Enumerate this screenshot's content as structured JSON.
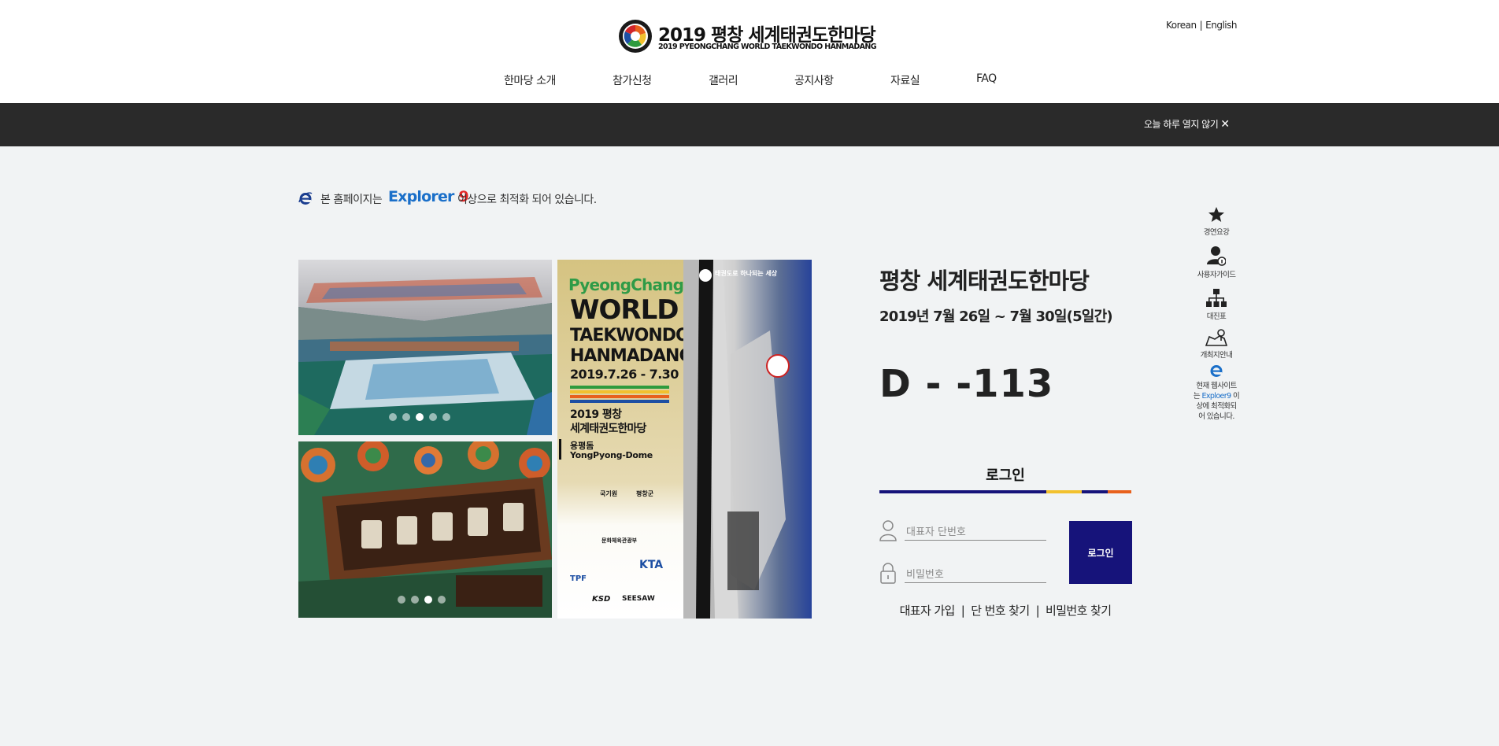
{
  "header": {
    "logo_title": "2019 평창 세계태권도한마당",
    "logo_subtitle": "2019 PYEONGCHANG WORLD TAEKWONDO HANMADANG",
    "lang_korean": "Korean",
    "lang_sep": "|",
    "lang_english": "English"
  },
  "nav": {
    "items": [
      {
        "label": "한마당 소개"
      },
      {
        "label": "참가신청"
      },
      {
        "label": "갤러리"
      },
      {
        "label": "공지사항"
      },
      {
        "label": "자료실"
      },
      {
        "label": "FAQ"
      }
    ]
  },
  "popup_bar": {
    "close_today": "오늘 하루 열지 않기",
    "close_icon": "✕"
  },
  "notice": {
    "text_before": "본 홈페이지는",
    "browser": "Explorer",
    "version": "9",
    "text_after": "이상으로 최적화 되어 있습니다."
  },
  "poster": {
    "brand": "PyeongChang",
    "line1": "WORLD",
    "line2": "TAEKWONDO",
    "line3": "HANMADANG",
    "dates": "2019.7.26 - 7.30",
    "ko_line1": "2019 평창",
    "ko_line2": "세계태권도한마당",
    "venue_ko": "용평돔",
    "venue_en": "YongPyong-Dome",
    "tagline": "태권도로 하나되는 세상",
    "sponsor_a": "국기원",
    "sponsor_b": "평창군",
    "sponsor_c": "문화체육관광부",
    "sponsor_d": "KTA",
    "sponsor_e": "TPF",
    "sponsor_f": "KSD",
    "sponsor_g": "SEESAW"
  },
  "quick_menu": [
    {
      "icon": "star-icon",
      "label": "경연요강"
    },
    {
      "icon": "user-guide-icon",
      "label": "사용자가이드"
    },
    {
      "icon": "org-chart-icon",
      "label": "대진표"
    },
    {
      "icon": "map-pin-icon",
      "label": "개최지안내"
    }
  ],
  "quick_notice": {
    "line1": "현재 웹사이트",
    "line2_pre": "는",
    "line2_brand": "Exploer9",
    "line2_post": "이",
    "line3": "상에 최적화되",
    "line4": "어 있습니다."
  },
  "event": {
    "title": "평창 세계태권도한마당",
    "date": "2019년 7월 26일 ~ 7월 30일(5일간)",
    "dday": "D - -113"
  },
  "login": {
    "title": "로그인",
    "id_placeholder": "대표자 단번호",
    "pw_placeholder": "비밀번호",
    "button": "로그인",
    "link_signup": "대표자 가입",
    "link_find_id": "단 번호 찾기",
    "link_find_pw": "비밀번호 찾기",
    "sep": "|"
  },
  "slider": {
    "top_active": 3,
    "top_count": 5,
    "bottom_active": 3,
    "bottom_count": 4
  },
  "colors": {
    "dark_bar": "#2a2a2a",
    "page_bg": "#f1f3f4",
    "login_button": "#16137a",
    "brand_blue": "#1a6fc9",
    "brand_red": "#e32626",
    "rule_navy": "#16137a",
    "rule_yellow": "#f2c12e",
    "rule_orange": "#e8611c"
  }
}
